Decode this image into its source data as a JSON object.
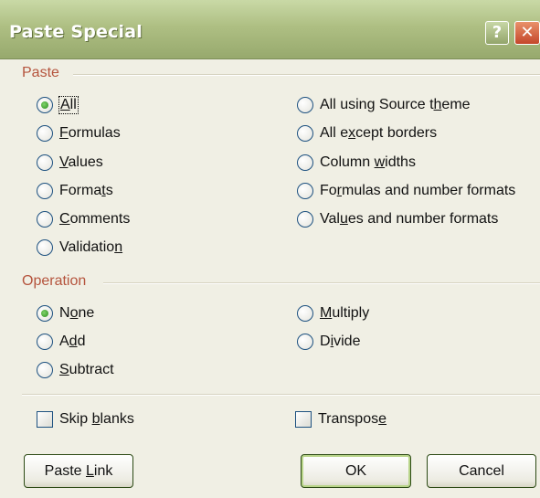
{
  "window": {
    "title": "Paste Special",
    "help_glyph": "?",
    "close_glyph": "✕"
  },
  "paste": {
    "heading": "Paste",
    "left": [
      {
        "pre": "",
        "key": "A",
        "post": "ll",
        "checked": true,
        "focused": true
      },
      {
        "pre": "",
        "key": "F",
        "post": "ormulas",
        "checked": false
      },
      {
        "pre": "",
        "key": "V",
        "post": "alues",
        "checked": false
      },
      {
        "pre": "Forma",
        "key": "t",
        "post": "s",
        "checked": false
      },
      {
        "pre": "",
        "key": "C",
        "post": "omments",
        "checked": false
      },
      {
        "pre": "Validatio",
        "key": "n",
        "post": "",
        "checked": false
      }
    ],
    "right": [
      {
        "pre": "All using Source t",
        "key": "h",
        "post": "eme",
        "checked": false
      },
      {
        "pre": "All e",
        "key": "x",
        "post": "cept borders",
        "checked": false
      },
      {
        "pre": "Column ",
        "key": "w",
        "post": "idths",
        "checked": false
      },
      {
        "pre": "Fo",
        "key": "r",
        "post": "mulas and number formats",
        "checked": false
      },
      {
        "pre": "Val",
        "key": "u",
        "post": "es and number formats",
        "checked": false
      }
    ]
  },
  "operation": {
    "heading": "Operation",
    "left": [
      {
        "pre": "N",
        "key": "o",
        "post": "ne",
        "checked": true
      },
      {
        "pre": "A",
        "key": "d",
        "post": "d",
        "checked": false
      },
      {
        "pre": "",
        "key": "S",
        "post": "ubtract",
        "checked": false
      }
    ],
    "right": [
      {
        "pre": "",
        "key": "M",
        "post": "ultiply",
        "checked": false
      },
      {
        "pre": "D",
        "key": "i",
        "post": "vide",
        "checked": false
      }
    ]
  },
  "options": {
    "skip_blanks": {
      "pre": "Skip ",
      "key": "b",
      "post": "lanks",
      "checked": false
    },
    "transpose": {
      "pre": "Transpos",
      "key": "e",
      "post": "",
      "checked": false
    }
  },
  "buttons": {
    "paste_link": {
      "pre": "Paste ",
      "key": "L",
      "post": "ink"
    },
    "ok": "OK",
    "cancel": "Cancel"
  }
}
